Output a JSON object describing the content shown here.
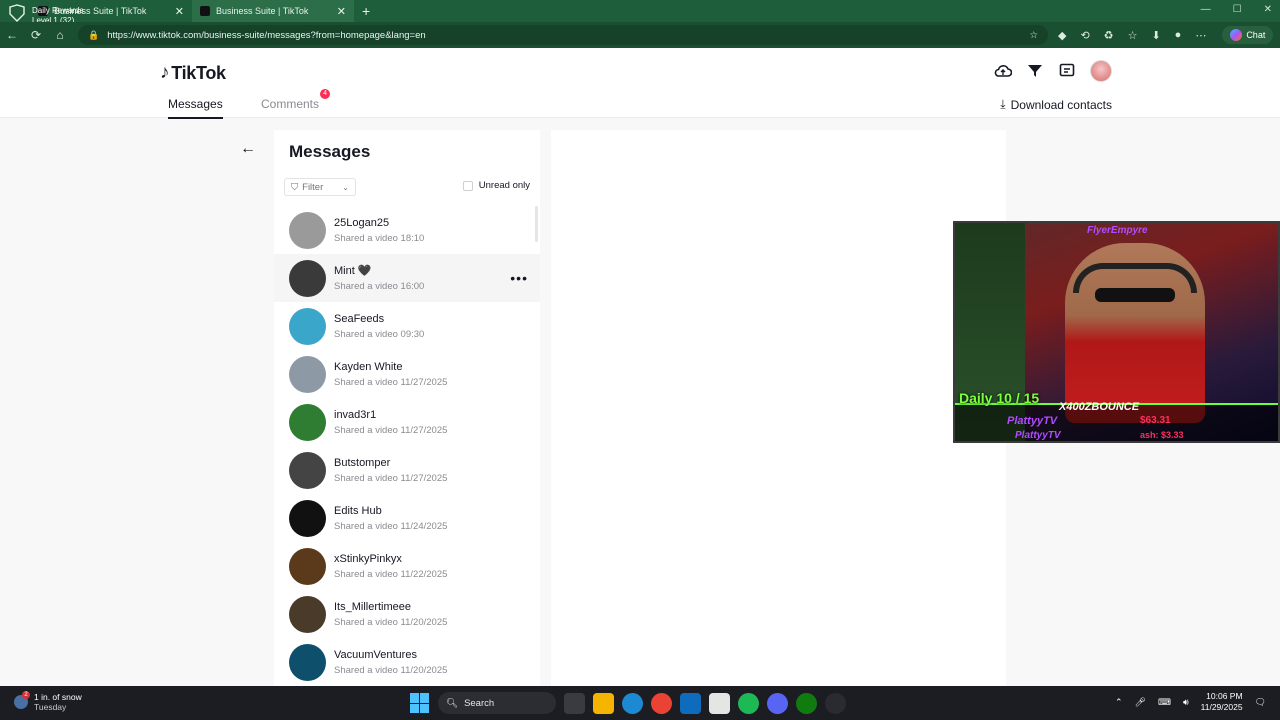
{
  "browser": {
    "overlay_line1": "Daily Rewards",
    "overlay_line2": "Level 1  (32)",
    "tabs": [
      {
        "title": "Business Suite | TikTok",
        "close": "✕"
      },
      {
        "title": "Business Suite | TikTok",
        "close": "✕"
      }
    ],
    "new_tab": "+",
    "url": "https://www.tiktok.com/business-suite/messages?from=homepage&lang=en",
    "chat_label": "Chat"
  },
  "header": {
    "logo_text": "TikTok",
    "tabs": {
      "messages": "Messages",
      "comments": "Comments",
      "comments_badge": "4"
    },
    "download_label": "Download contacts"
  },
  "messages_panel": {
    "title": "Messages",
    "filter_label": "Filter",
    "unread_only_label": "Unread only",
    "conversations": [
      {
        "name": "25Logan25",
        "preview": "Shared a video 18:10",
        "avatar_color": "#9a9a9a"
      },
      {
        "name": "Mint 🖤",
        "preview": "Shared a video 16:00",
        "avatar_color": "#3a3a3a"
      },
      {
        "name": "SeaFeeds",
        "preview": "Shared a video 09:30",
        "avatar_color": "#3aa6c9"
      },
      {
        "name": "Kayden White",
        "preview": "Shared a video 11/27/2025",
        "avatar_color": "#8d9aa6"
      },
      {
        "name": "invad3r1",
        "preview": "Shared a video 11/27/2025",
        "avatar_color": "#2e7d32"
      },
      {
        "name": "Butstomper",
        "preview": "Shared a video 11/27/2025",
        "avatar_color": "#444444"
      },
      {
        "name": "Edits Hub",
        "preview": "Shared a video 11/24/2025",
        "avatar_color": "#111111"
      },
      {
        "name": "xStinkyPinkyx",
        "preview": "Shared a video 11/22/2025",
        "avatar_color": "#5a3a1a"
      },
      {
        "name": "Its_Millertimeee",
        "preview": "Shared a video 11/20/2025",
        "avatar_color": "#4a3a2a"
      },
      {
        "name": "VacuumVentures",
        "preview": "Shared a video 11/20/2025",
        "avatar_color": "#0e4f6b"
      }
    ],
    "more_label": "•••"
  },
  "stream_overlay": {
    "top_name": "FlyerEmpyre",
    "daily": "Daily 10 / 15",
    "big_name": "X400ZBOUNCE",
    "name_line1": "PlattyyTV",
    "name_line2": "PlattyyTV",
    "money_line1": "$63.31",
    "money_line2": "ash: $3.33"
  },
  "taskbar": {
    "weather_title": "1 in. of snow",
    "weather_sub": "Tuesday",
    "weather_badge": "2",
    "search_label": "Search",
    "time": "10:06 PM",
    "date": "11/29/2025"
  }
}
